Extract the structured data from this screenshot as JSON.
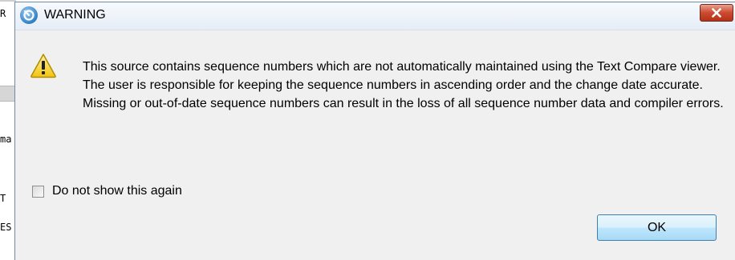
{
  "background_editor": {
    "fragments": [
      "R",
      "ma",
      "T",
      "ES"
    ]
  },
  "dialog": {
    "app_icon": "app-logo-icon",
    "title": "WARNING",
    "close_icon": "close-icon",
    "warning_icon": "warning-triangle-icon",
    "message": "This source contains sequence numbers which are not automatically maintained using the Text Compare viewer. The user is responsible for keeping the sequence numbers in ascending order and the change date accurate.  Missing or out-of-date sequence numbers can result in the loss of all sequence number data and compiler errors.",
    "checkbox": {
      "label": "Do not show this again",
      "checked": false
    },
    "ok_label": "OK"
  },
  "colors": {
    "dialog_bg": "#f0f0f0",
    "close_button": "#c7432a",
    "ok_button_border": "#3c7fb1"
  }
}
